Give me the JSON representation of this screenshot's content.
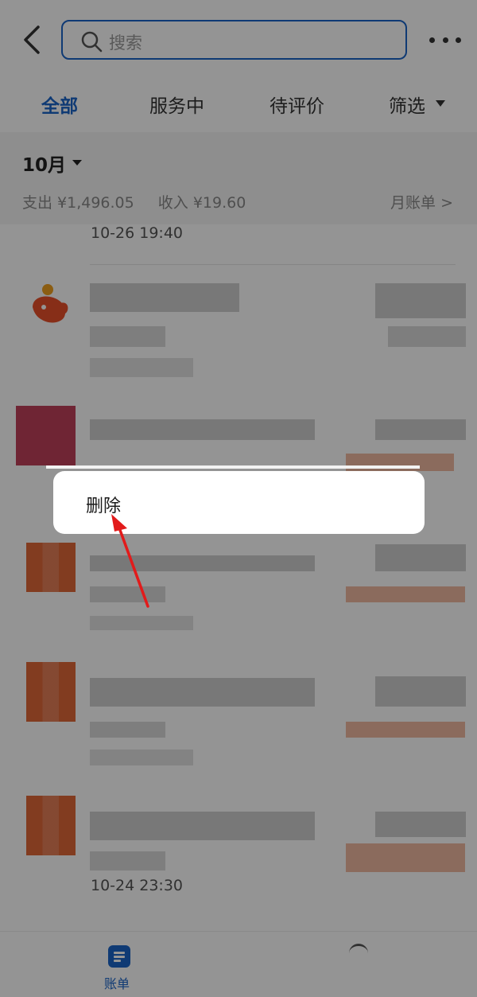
{
  "header": {
    "search_placeholder": "搜索"
  },
  "tabs": [
    {
      "label": "全部",
      "active": true
    },
    {
      "label": "服务中",
      "active": false
    },
    {
      "label": "待评价",
      "active": false
    },
    {
      "label": "筛选",
      "active": false
    }
  ],
  "month": {
    "label": "10月",
    "expense": "支出 ¥1,496.05",
    "income": "收入 ¥19.60",
    "monthly_bill": "月账单 >"
  },
  "list": {
    "time_top": "10-26  19:40",
    "time_bottom": "10-24  23:30"
  },
  "context_menu": {
    "delete_label": "删除"
  },
  "bottom_nav": {
    "bill_label": "账单"
  },
  "colors": {
    "accent": "#1a64c8",
    "annotation_arrow": "#e21b1b"
  }
}
